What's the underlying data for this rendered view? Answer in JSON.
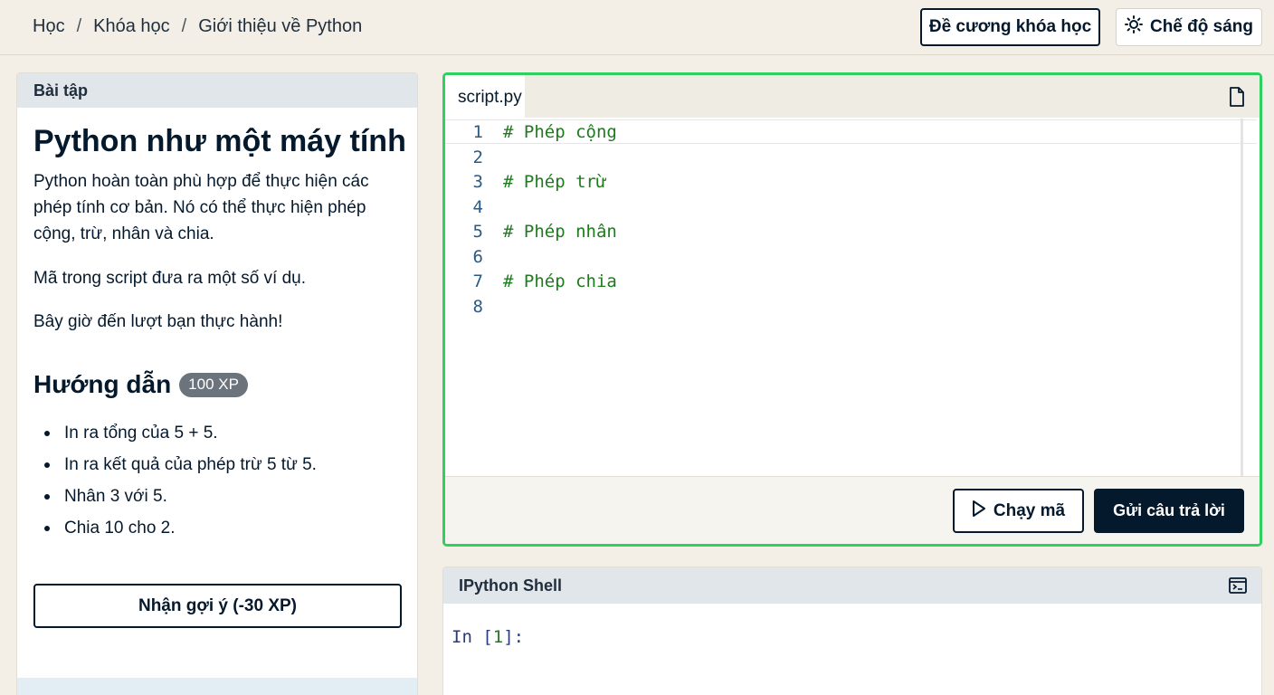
{
  "header": {
    "breadcrumb": [
      "Học",
      "Khóa học",
      "Giới thiệu về Python"
    ],
    "course_outline_label": "Đề cương khóa học",
    "theme_toggle_label": "Chế độ sáng"
  },
  "exercise": {
    "panel_title": "Bài tập",
    "title": "Python như một máy tính",
    "paragraphs": [
      "Python hoàn toàn phù hợp để thực hiện các phép tính cơ bản. Nó có thể thực hiện phép cộng, trừ, nhân và chia.",
      "Mã trong script đưa ra một số ví dụ.",
      "Bây giờ đến lượt bạn thực hành!"
    ],
    "instructions_title": "Hướng dẫn",
    "xp": "100 XP",
    "instructions": [
      "In ra tổng của 5 + 5.",
      "In ra kết quả của phép trừ 5 từ 5.",
      "Nhân 3 với 5.",
      "Chia 10 cho 2."
    ],
    "hint_label": "Nhận gợi ý (-30 XP)"
  },
  "editor": {
    "tab": "script.py",
    "lines": [
      {
        "n": "1",
        "code": "# Phép cộng"
      },
      {
        "n": "2",
        "code": ""
      },
      {
        "n": "3",
        "code": "# Phép trừ"
      },
      {
        "n": "4",
        "code": ""
      },
      {
        "n": "5",
        "code": "# Phép nhân"
      },
      {
        "n": "6",
        "code": ""
      },
      {
        "n": "7",
        "code": "# Phép chia"
      },
      {
        "n": "8",
        "code": ""
      }
    ],
    "run_label": "Chạy mã",
    "submit_label": "Gửi câu trả lời",
    "accent_color": "#2fd05f"
  },
  "shell": {
    "title": "IPython Shell",
    "prompt_prefix": "In [",
    "prompt_number": "1",
    "prompt_suffix": "]:"
  }
}
